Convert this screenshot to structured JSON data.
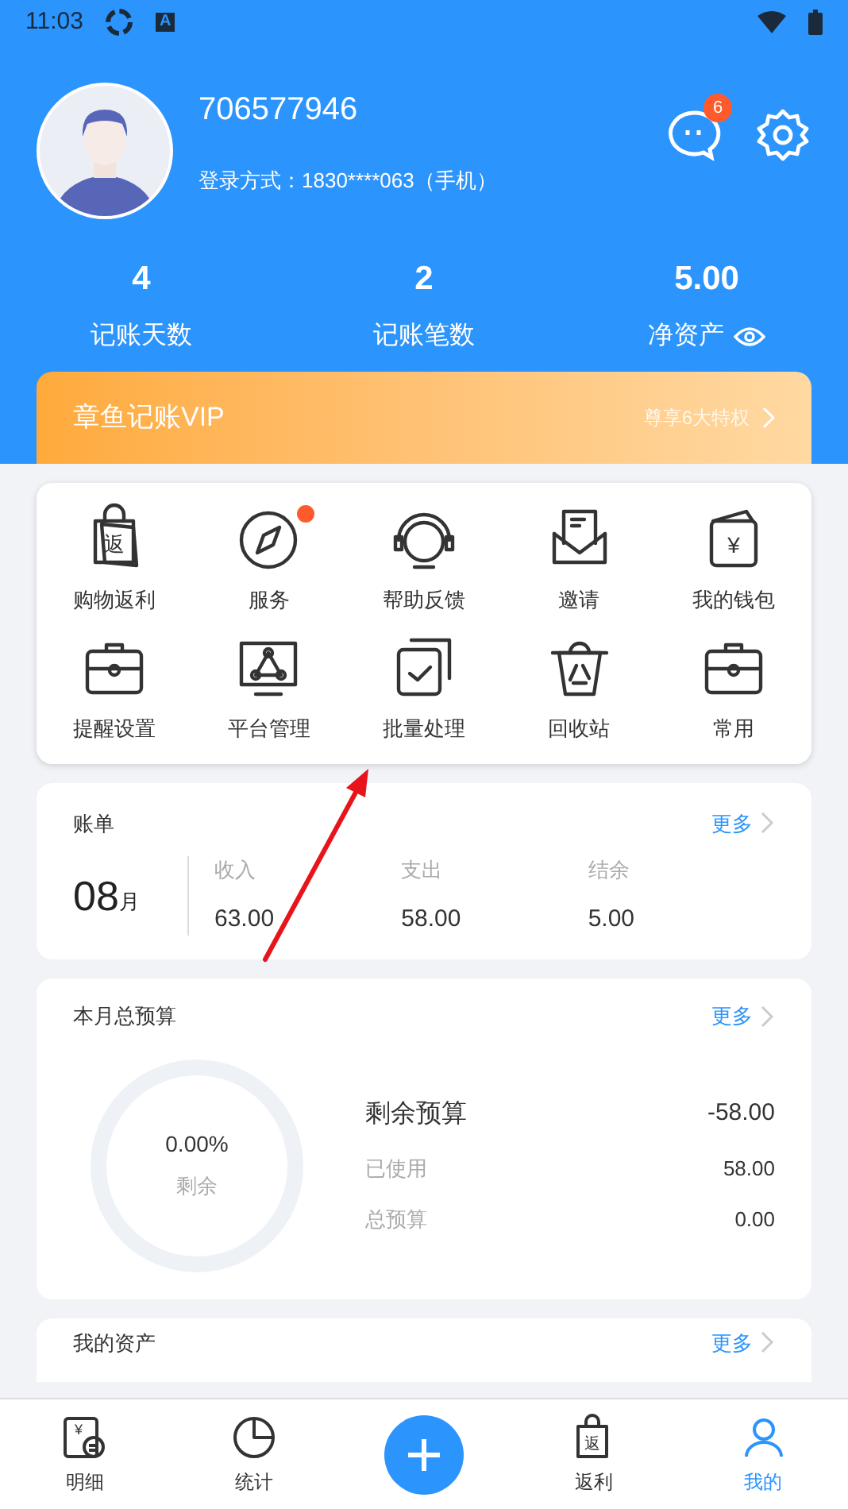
{
  "status_bar": {
    "time": "11:03",
    "app_icon_letter": "A"
  },
  "profile": {
    "user_id": "706577946",
    "login": "登录方式：1830****063（手机）",
    "messages_badge": "6"
  },
  "stats": [
    {
      "value": "4",
      "label": "记账天数",
      "eye": false
    },
    {
      "value": "2",
      "label": "记账笔数",
      "eye": false
    },
    {
      "value": "5.00",
      "label": "净资产",
      "eye": true
    }
  ],
  "vip": {
    "title": "章鱼记账VIP",
    "link": "尊享6大特权"
  },
  "grid": [
    {
      "label": "购物返利",
      "kind": "bag",
      "glyph": "返",
      "dot": false
    },
    {
      "label": "服务",
      "kind": "compass",
      "dot": true
    },
    {
      "label": "帮助反馈",
      "kind": "headset",
      "dot": false
    },
    {
      "label": "邀请",
      "kind": "envelope",
      "dot": false
    },
    {
      "label": "我的钱包",
      "kind": "wallet",
      "glyph": "¥",
      "dot": false
    },
    {
      "label": "提醒设置",
      "kind": "briefcase",
      "dot": false
    },
    {
      "label": "平台管理",
      "kind": "monitor",
      "dot": false
    },
    {
      "label": "批量处理",
      "kind": "check",
      "dot": false
    },
    {
      "label": "回收站",
      "kind": "trash",
      "dot": false
    },
    {
      "label": "常用",
      "kind": "briefcase",
      "dot": false
    }
  ],
  "bill": {
    "title": "账单",
    "more": "更多",
    "month": "08",
    "month_unit": "月",
    "columns": [
      {
        "label": "收入",
        "value": "63.00"
      },
      {
        "label": "支出",
        "value": "58.00"
      },
      {
        "label": "结余",
        "value": "5.00"
      }
    ]
  },
  "budget": {
    "title": "本月总预算",
    "more": "更多",
    "percent": "0.00%",
    "ring_label": "剩余",
    "level": 0,
    "main": {
      "label": "剩余预算",
      "value": "-58.00"
    },
    "rows": [
      {
        "label": "已使用",
        "value": "58.00"
      },
      {
        "label": "总预算",
        "value": "0.00"
      }
    ]
  },
  "assets": {
    "title": "我的资产",
    "more": "更多"
  },
  "bottom_nav": [
    {
      "kind": "tab",
      "glyph": "¥",
      "label": "明细",
      "selected": false
    },
    {
      "kind": "tab",
      "label": "统计",
      "selected": false
    },
    {
      "kind": "add"
    },
    {
      "kind": "tab",
      "glyph": "返",
      "label": "返利",
      "selected": false
    },
    {
      "kind": "tab",
      "label": "我的",
      "selected": true
    }
  ],
  "annotations": [
    {
      "kind": "arrow"
    }
  ]
}
